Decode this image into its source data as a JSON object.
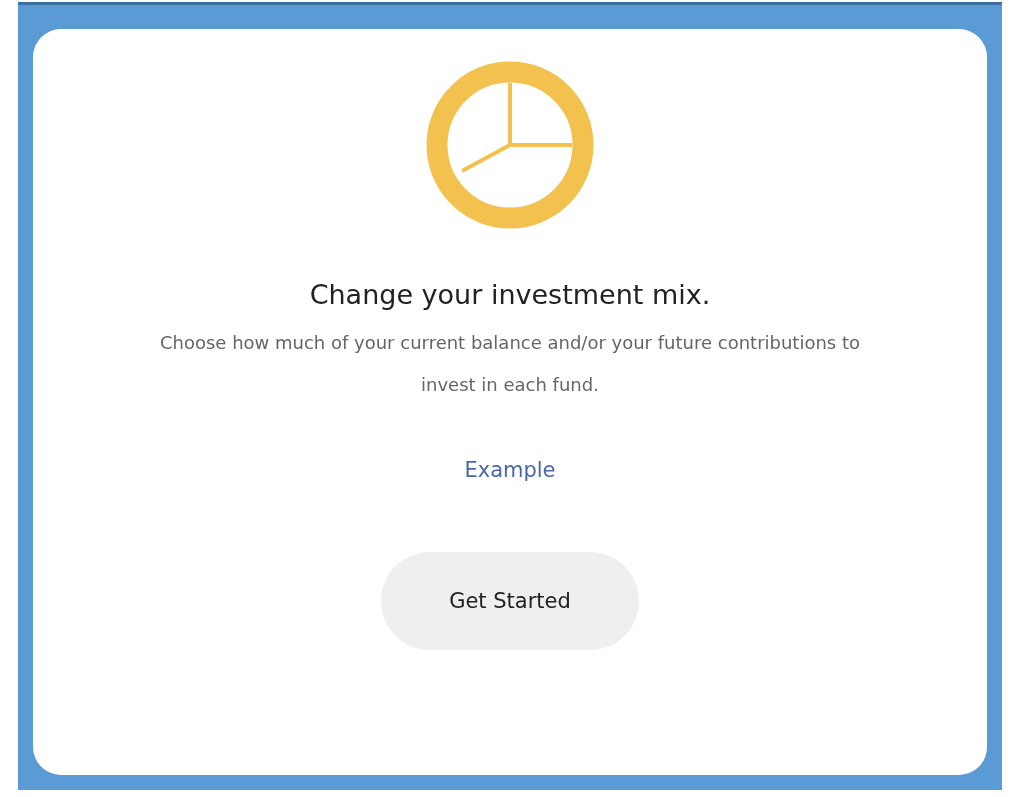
{
  "card": {
    "title": "Change your investment mix.",
    "description": "Choose how much of your current balance and/or your future contributions to invest in each fund.",
    "link": "Example",
    "button": "Get Started"
  }
}
